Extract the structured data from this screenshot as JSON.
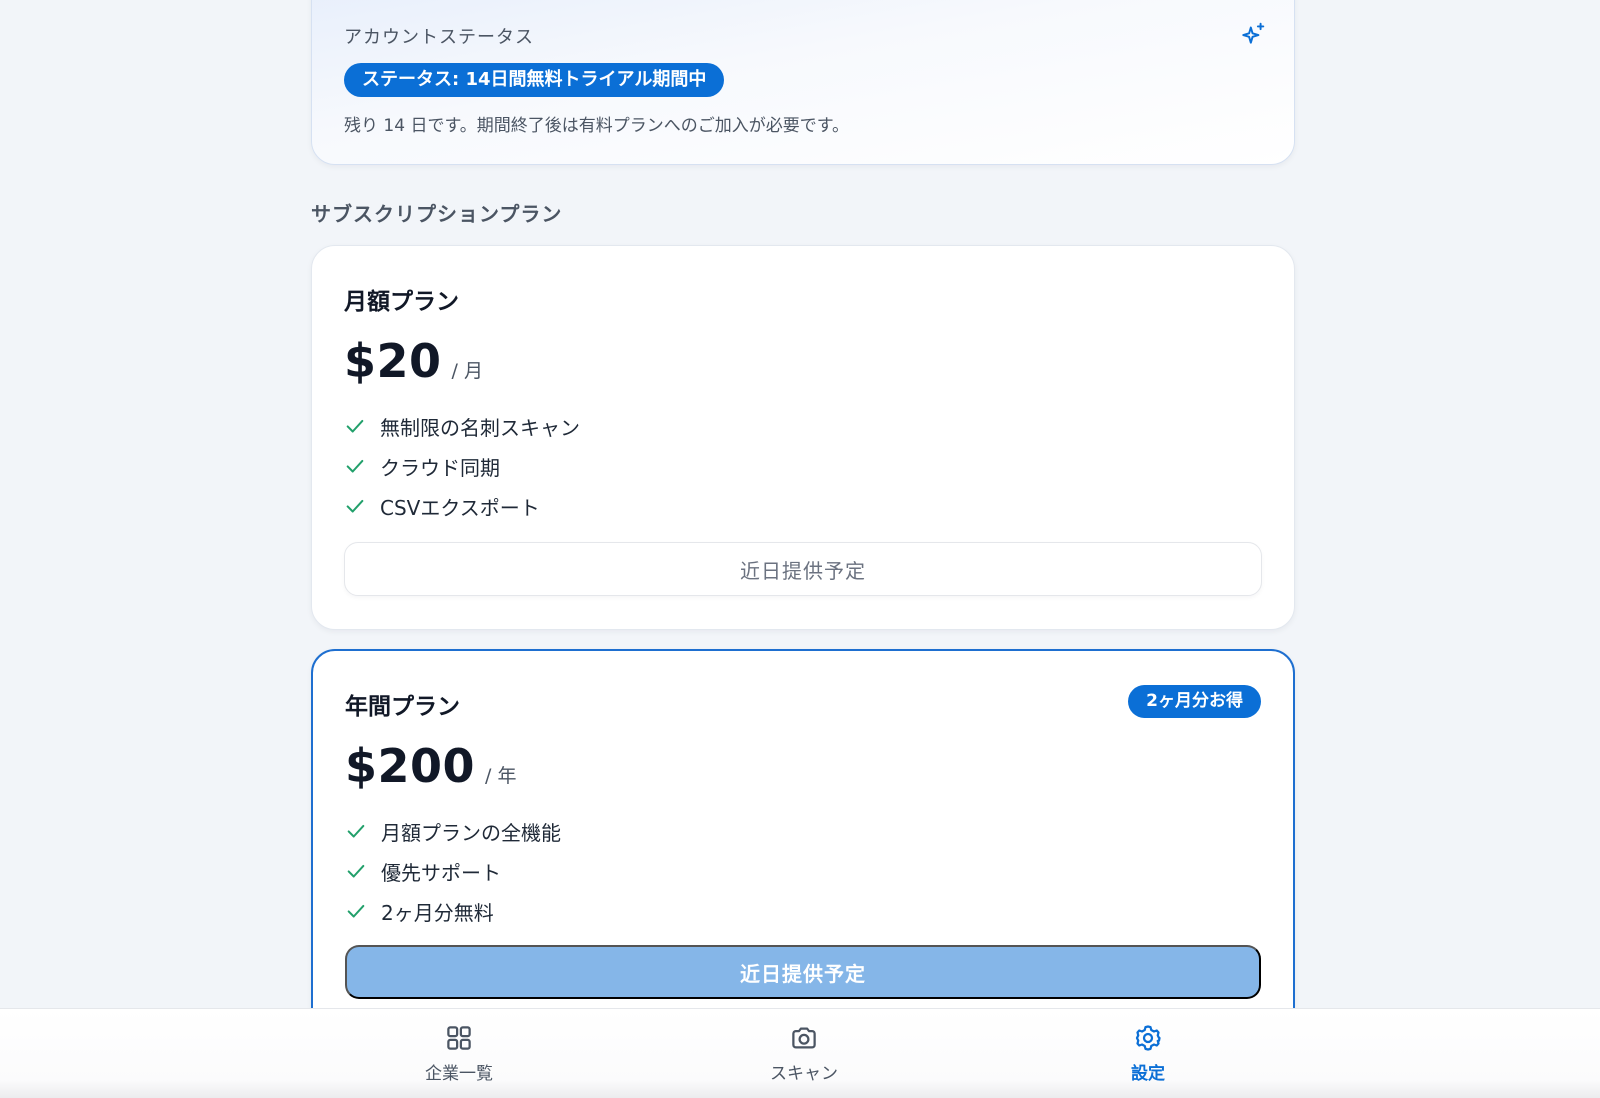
{
  "status": {
    "title": "アカウントステータス",
    "badge": "ステータス: 14日間無料トライアル期間中",
    "description": "残り 14 日です。期間終了後は有料プランへのご加入が必要です。",
    "icon": "sparkle-icon"
  },
  "section_title": "サブスクリプションプラン",
  "plans": [
    {
      "name": "月額プラン",
      "price": "$20",
      "period": "/ 月",
      "features": [
        "無制限の名刺スキャン",
        "クラウド同期",
        "CSVエクスポート"
      ],
      "cta": "近日提供予定"
    },
    {
      "name": "年間プラン",
      "badge": "2ヶ月分お得",
      "price": "$200",
      "period": "/ 年",
      "features": [
        "月額プランの全機能",
        "優先サポート",
        "2ヶ月分無料"
      ],
      "cta": "近日提供予定"
    }
  ],
  "nav": {
    "items": [
      {
        "label": "企業一覧",
        "icon": "grid-icon"
      },
      {
        "label": "スキャン",
        "icon": "camera-icon"
      },
      {
        "label": "設定",
        "icon": "gear-icon",
        "active": true
      }
    ]
  },
  "colors": {
    "accent": "#0b6fd6",
    "check": "#22a06b",
    "cta_disabled": "#85b6e8"
  }
}
